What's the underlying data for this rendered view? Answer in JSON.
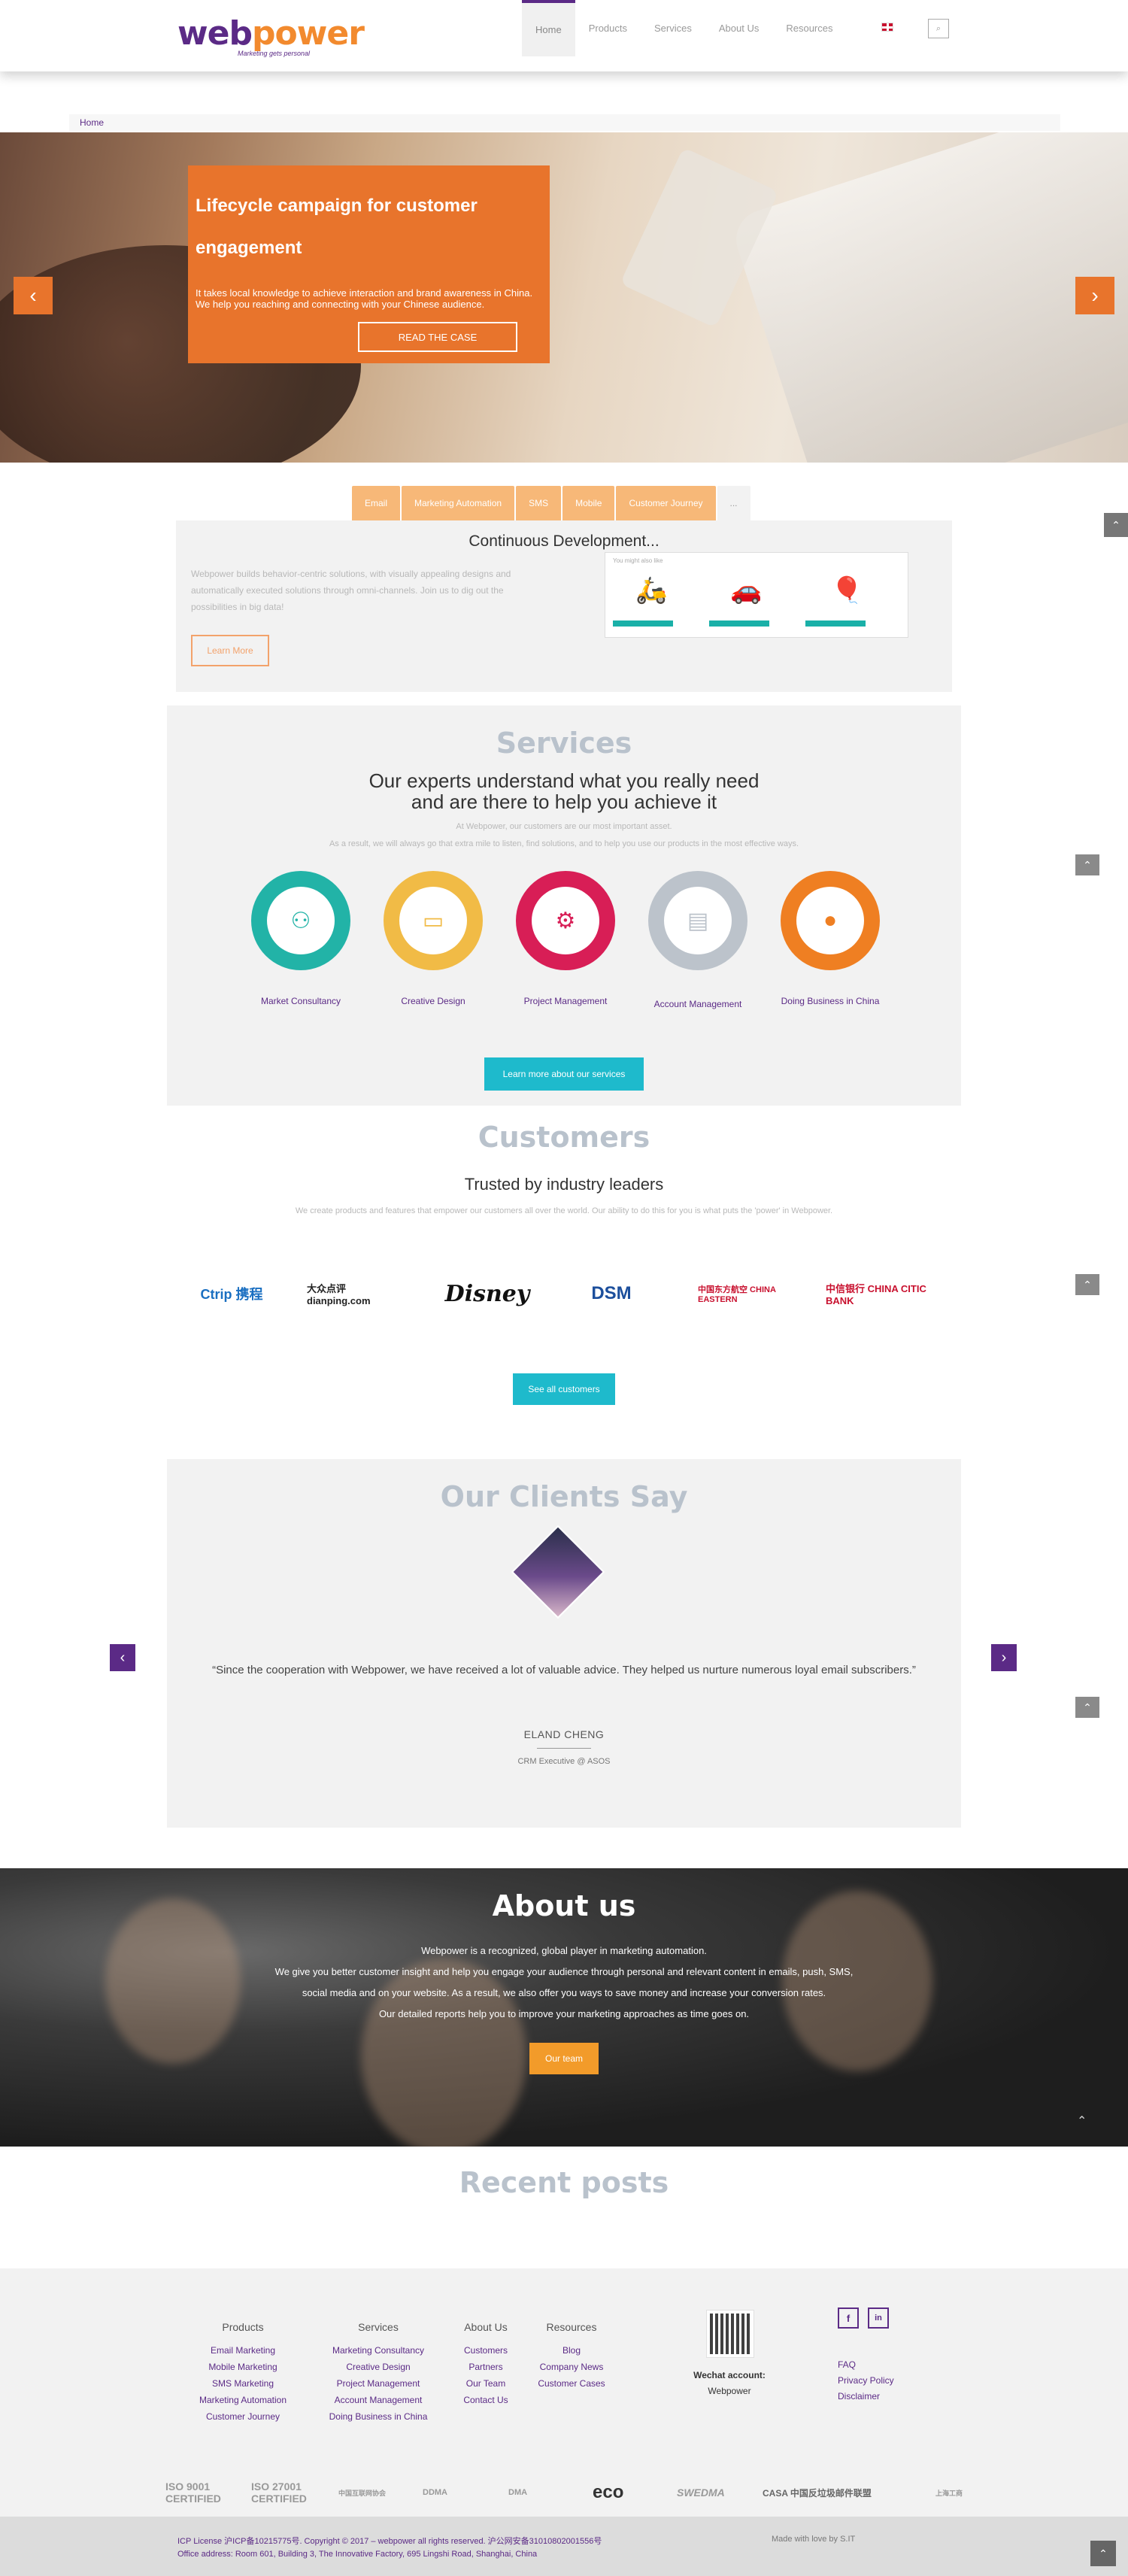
{
  "header": {
    "logo_word_a": "web",
    "logo_word_b": "power",
    "logo_tagline": "Marketing gets personal",
    "nav": [
      "Home",
      "Products",
      "Services",
      "About Us",
      "Resources"
    ],
    "search_icon_glyph": "⌕"
  },
  "breadcrumb": "Home",
  "hero": {
    "title": "Lifecycle campaign for customer engagement",
    "text": "It takes local knowledge to achieve interaction and brand awareness in China. We help you reaching and connecting with your Chinese audience.",
    "cta": "READ THE CASE",
    "prev": "‹",
    "next": "›"
  },
  "product_tabs": {
    "tabs": [
      "Email",
      "Marketing Automation",
      "SMS",
      "Mobile",
      "Customer Journey",
      "..."
    ],
    "panel_title": "Continuous Development...",
    "panel_text": "Webpower builds behavior-centric solutions, with visually appealing designs and automatically executed solutions through omni-channels. Join us to dig out the possibilities in big data!",
    "panel_button": "Learn More",
    "mock_label": "You might also like"
  },
  "services": {
    "title": "Services",
    "heading_1": "Our experts understand what you really need",
    "heading_2": "and are there to help you achieve it",
    "sub_1": "At Webpower, our customers are our most important asset.",
    "sub_2": "As a result, we will always go that extra mile to listen, find solutions, and to help you use our products in the most effective ways.",
    "items": [
      {
        "label": "Market Consultancy",
        "color": "#22b3a7",
        "icon": "org-chart-icon"
      },
      {
        "label": "Creative Design",
        "color": "#f1bb46",
        "icon": "design-screen-icon"
      },
      {
        "label": "Project Management",
        "color": "#d81e56",
        "icon": "gear-screen-icon"
      },
      {
        "label": "Account Management",
        "color": "#bcc3cb",
        "icon": "id-card-icon"
      },
      {
        "label": "Doing Business in China",
        "color": "#ef7f22",
        "icon": "china-lantern-icon"
      }
    ],
    "button": "Learn more about our services"
  },
  "customers": {
    "title": "Customers",
    "heading": "Trusted by industry leaders",
    "sub": "We create products and features that empower our customers all over the world. Our ability to do this for you is what puts the 'power' in Webpower.",
    "logos": [
      "Ctrip 携程",
      "大众点评 dianping.com",
      "Disney",
      "DSM",
      "中国东方航空 CHINA EASTERN",
      "中信银行 CHINA CITIC BANK"
    ],
    "button": "See all customers"
  },
  "testimonials": {
    "title": "Our Clients Say",
    "quote": "“Since the cooperation with Webpower, we have received a lot of valuable advice. They helped us nurture numerous loyal email subscribers.”",
    "author": "ELAND CHENG",
    "role": "CRM Executive @ ASOS",
    "prev": "‹",
    "next": "›"
  },
  "about": {
    "title": "About us",
    "lines": [
      "Webpower is a recognized, global player in marketing automation.",
      "We give you better customer insight and help you engage your audience through personal and relevant content in emails, push, SMS,",
      "social media and on your website. As a result, we also offer you ways to save money and increase your conversion rates.",
      "Our detailed reports help you to improve your marketing approaches as time goes on."
    ],
    "button": "Our team"
  },
  "recent_posts": {
    "title": "Recent posts"
  },
  "footer": {
    "columns": [
      {
        "heading": "Products",
        "links": [
          "Email Marketing",
          "Mobile Marketing",
          "SMS Marketing",
          "Marketing Automation",
          "Customer Journey"
        ]
      },
      {
        "heading": "Services",
        "links": [
          "Marketing Consultancy",
          "Creative Design",
          "Project Management",
          "Account Management",
          "Doing Business in China"
        ]
      },
      {
        "heading": "About Us",
        "links": [
          "Customers",
          "Partners",
          "Our Team",
          "Contact Us"
        ]
      },
      {
        "heading": "Resources",
        "links": [
          "Blog",
          "Company News",
          "Customer Cases"
        ]
      }
    ],
    "wechat_label": "Wechat account:",
    "wechat_name": "Webpower",
    "social": [
      "f",
      "in"
    ],
    "extra_links": [
      "FAQ",
      "Privacy Policy",
      "Disclaimer"
    ],
    "certs": [
      "ISO 9001 CERTIFIED",
      "ISO 27001 CERTIFIED",
      "中国互联网协会",
      "DDMA",
      "DMA",
      "eco",
      "SWEDMA",
      "CASA 中国反垃圾邮件联盟",
      "上海工商"
    ],
    "license": "ICP License 沪ICP备10215775号. Copyright © 2017 – webpower all rights reserved. 沪公网安备31010802001556号",
    "address": "Office address: Room 601, Building 3, The Innovative Factory, 695 Lingshi Road, Shanghai, China",
    "made_by": "Made with love by S.IT"
  },
  "ui": {
    "up": "⌃"
  }
}
